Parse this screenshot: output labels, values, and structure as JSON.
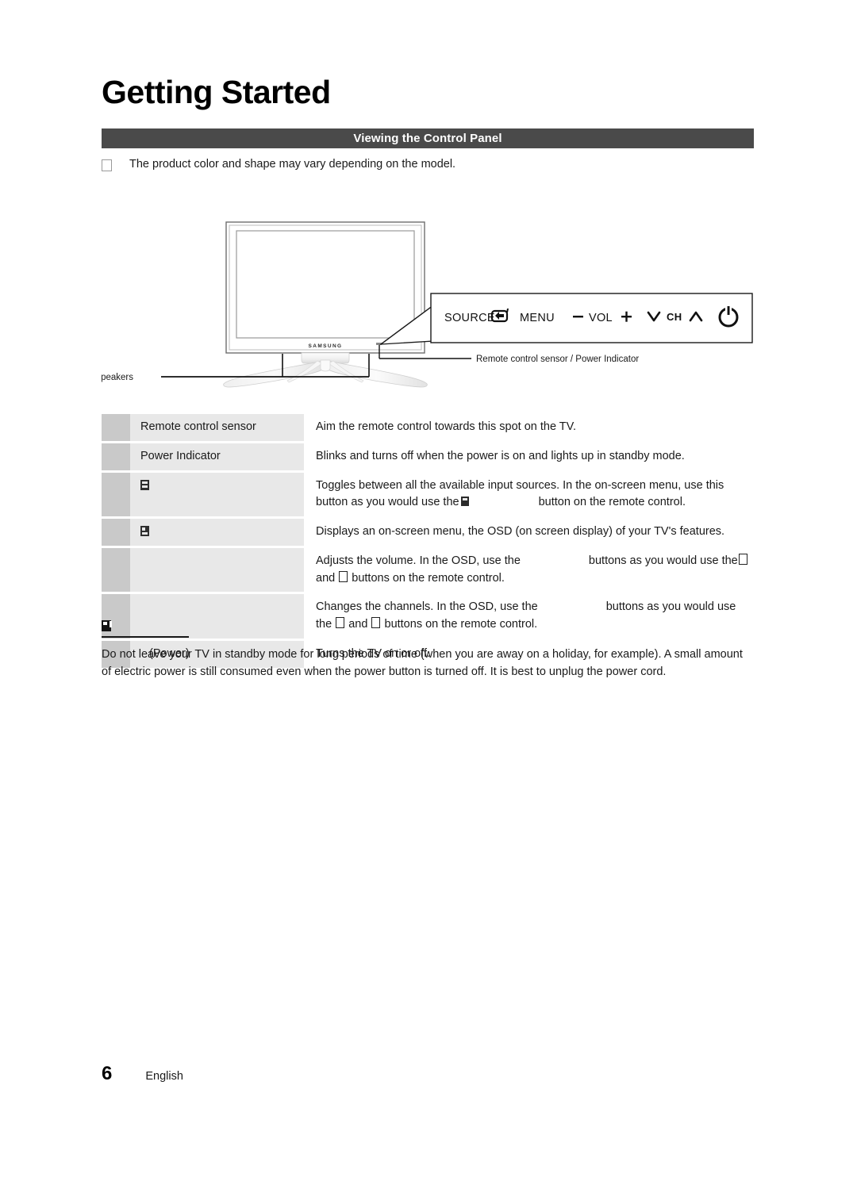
{
  "document": {
    "chapter_title": "Getting Started",
    "section_bar_title": "Viewing the Control Panel",
    "intro_note": "The product color and shape may vary depending on the model.",
    "footer": {
      "page_number": "6",
      "language": "English"
    }
  },
  "figure": {
    "brand_logo": "SAMSUNG",
    "callouts": {
      "speakers": "Speakers",
      "sensor": "Remote control sensor / Power Indicator"
    },
    "control_panel": {
      "source_label": "SOURCE",
      "source_icon": "enter-arrow-icon",
      "menu_label": "MENU",
      "vol_minus": "–",
      "vol_label": "VOL",
      "vol_plus": "+",
      "ch_down": "∨",
      "ch_label": "CH",
      "ch_up": "∧",
      "power_icon": "power-icon"
    }
  },
  "control_table": {
    "rows": [
      {
        "icon": "",
        "label": "Remote control sensor",
        "desc_segments": [
          {
            "type": "text",
            "value": "Aim the remote control towards this spot on the TV."
          }
        ]
      },
      {
        "icon": "",
        "label": "Power Indicator",
        "desc_segments": [
          {
            "type": "text",
            "value": "Blinks and turns off when the power is on and lights up in standby mode."
          }
        ]
      },
      {
        "icon": "source-glyph",
        "label": "",
        "desc_segments": [
          {
            "type": "text",
            "value": "Toggles between all the available input sources. In the on-screen menu, use this button as you would use the "
          },
          {
            "type": "glyph",
            "value": "enter-glyph"
          },
          {
            "type": "gap",
            "value": "wide"
          },
          {
            "type": "text",
            "value": "button on the remote control."
          }
        ]
      },
      {
        "icon": "menu-glyph",
        "label": "",
        "desc_segments": [
          {
            "type": "text",
            "value": "Displays an on-screen menu, the OSD (on screen display) of your TV's features."
          }
        ]
      },
      {
        "icon": "",
        "label": "",
        "desc_segments": [
          {
            "type": "text",
            "value": "Adjusts the volume. In the OSD, use the"
          },
          {
            "type": "gap",
            "value": "wide"
          },
          {
            "type": "text",
            "value": "buttons as you would use the "
          },
          {
            "type": "glyph",
            "value": "missing-glyph"
          },
          {
            "type": "text",
            "value": " and "
          },
          {
            "type": "glyph",
            "value": "missing-glyph"
          },
          {
            "type": "text",
            "value": " buttons on the remote control."
          }
        ]
      },
      {
        "icon": "",
        "label": "",
        "desc_segments": [
          {
            "type": "text",
            "value": "Changes the channels. In the OSD, use the"
          },
          {
            "type": "gap",
            "value": "wide"
          },
          {
            "type": "text",
            "value": "buttons as you would use the "
          },
          {
            "type": "glyph",
            "value": "missing-glyph"
          },
          {
            "type": "text",
            "value": " and "
          },
          {
            "type": "glyph",
            "value": "missing-glyph"
          },
          {
            "type": "text",
            "value": " buttons on the remote control."
          }
        ]
      },
      {
        "icon": "",
        "label": "(Power)",
        "desc_segments": [
          {
            "type": "text",
            "value": "Turns the TV on or off."
          }
        ]
      }
    ],
    "row_texts": {
      "r1_label": "Remote control sensor",
      "r1_desc": "Aim the remote control towards this spot on the TV.",
      "r2_label": "Power Indicator",
      "r2_desc": "Blinks and turns off when the power is on and lights up in standby mode.",
      "r3_desc_a": "Toggles between all the available input sources. In the on-screen menu, use this button as you would use the",
      "r3_desc_b": "button on the remote control.",
      "r4_desc": "Displays an on-screen menu, the OSD (on screen display) of your TV's features.",
      "r5_desc_a": "Adjusts the volume. In the OSD, use the",
      "r5_desc_b": "buttons as you would use the",
      "r5_desc_c": "and",
      "r5_desc_d": "buttons on the remote control.",
      "r6_desc_a": "Changes the channels. In the OSD, use the",
      "r6_desc_b": "buttons as you would use the",
      "r6_desc_c": "and",
      "r6_desc_d": "buttons on the remote control.",
      "r7_label": "(Power)",
      "r7_desc": "Turns the TV on or off."
    }
  },
  "note": {
    "icon": "note-glyph",
    "text": "Do not leave your TV in standby mode for long periods of time (when you are away on a holiday, for example). A small amount of electric power is still consumed even when the power button is turned off. It is best to unplug the power cord."
  },
  "colors": {
    "section_bar_bg": "#4a4a4a",
    "table_icon_cell": "#c9c9c9",
    "table_label_cell": "#e8e8e8",
    "text": "#1a1a1a"
  }
}
